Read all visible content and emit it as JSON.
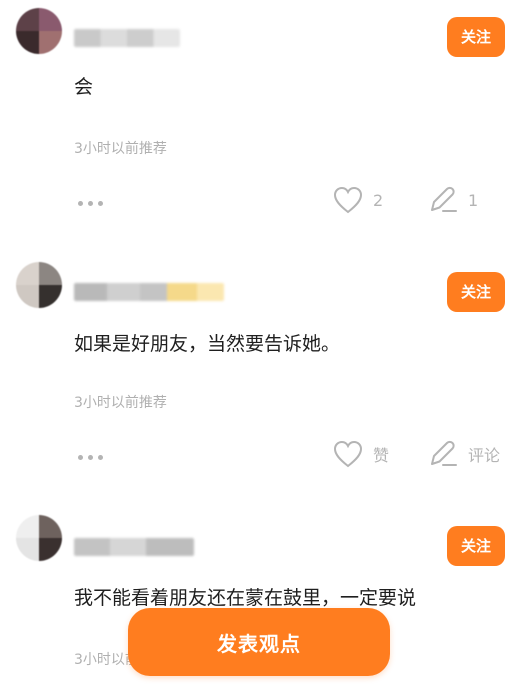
{
  "comments": [
    {
      "follow_label": "关注",
      "text": "会",
      "timestamp": "3小时以前推荐",
      "like_count": "2",
      "comment_count": "1"
    },
    {
      "follow_label": "关注",
      "text": "如果是好朋友，当然要告诉她。",
      "timestamp": "3小时以前推荐",
      "like_label": "赞",
      "comment_label": "评论"
    },
    {
      "follow_label": "关注",
      "text": "我不能看着朋友还在蒙在鼓里，一定要说",
      "timestamp": "3小时以前推荐"
    }
  ],
  "publish_button": "发表观点",
  "colors": {
    "accent": "#ff7d1f",
    "muted_text": "#b0b0b0",
    "icon_gray": "#b4b4b4"
  },
  "icons": {
    "like": "heart-outline-icon",
    "comment": "pencil-comment-icon",
    "more": "ellipsis-icon"
  }
}
